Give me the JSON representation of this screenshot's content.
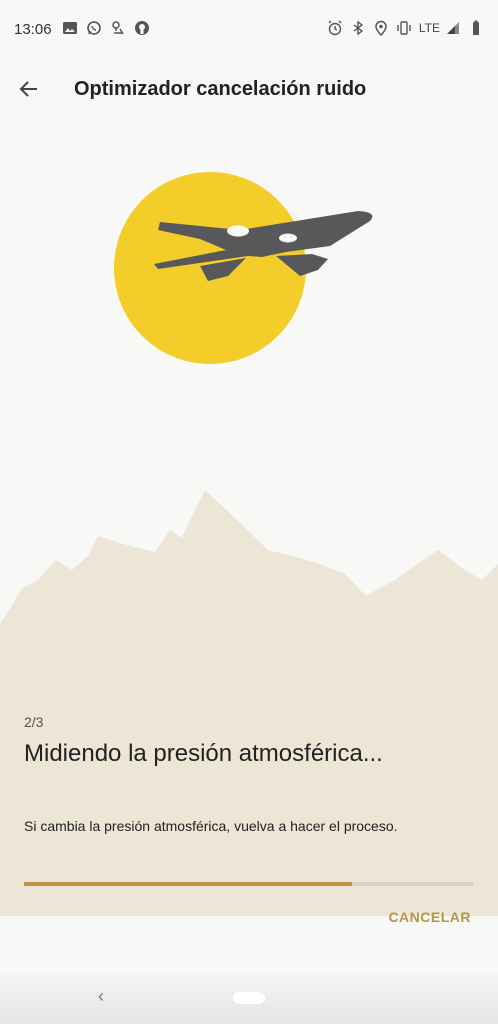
{
  "status_bar": {
    "time": "13:06",
    "network": "LTE",
    "left_icons": [
      "image-icon",
      "whatsapp-icon",
      "maps-icon",
      "github-icon"
    ],
    "right_icons": [
      "alarm-icon",
      "bluetooth-icon",
      "location-icon",
      "vibrate-icon",
      "signal-icon",
      "battery-icon"
    ]
  },
  "app_bar": {
    "title": "Optimizador cancelación ruido",
    "back_icon": "arrow-back-icon"
  },
  "content": {
    "step": "2/3",
    "headline": "Midiendo la presión atmosférica...",
    "description": "Si cambia la presión atmosférica, vuelva a hacer el proceso.",
    "progress": 0.73
  },
  "actions": {
    "cancel_label": "CANCELAR"
  },
  "colors": {
    "accent": "#b79546",
    "sun": "#f3cd2a",
    "plane": "#58585a",
    "mountains": "#ede5d6",
    "background": "#f8f8f7"
  }
}
